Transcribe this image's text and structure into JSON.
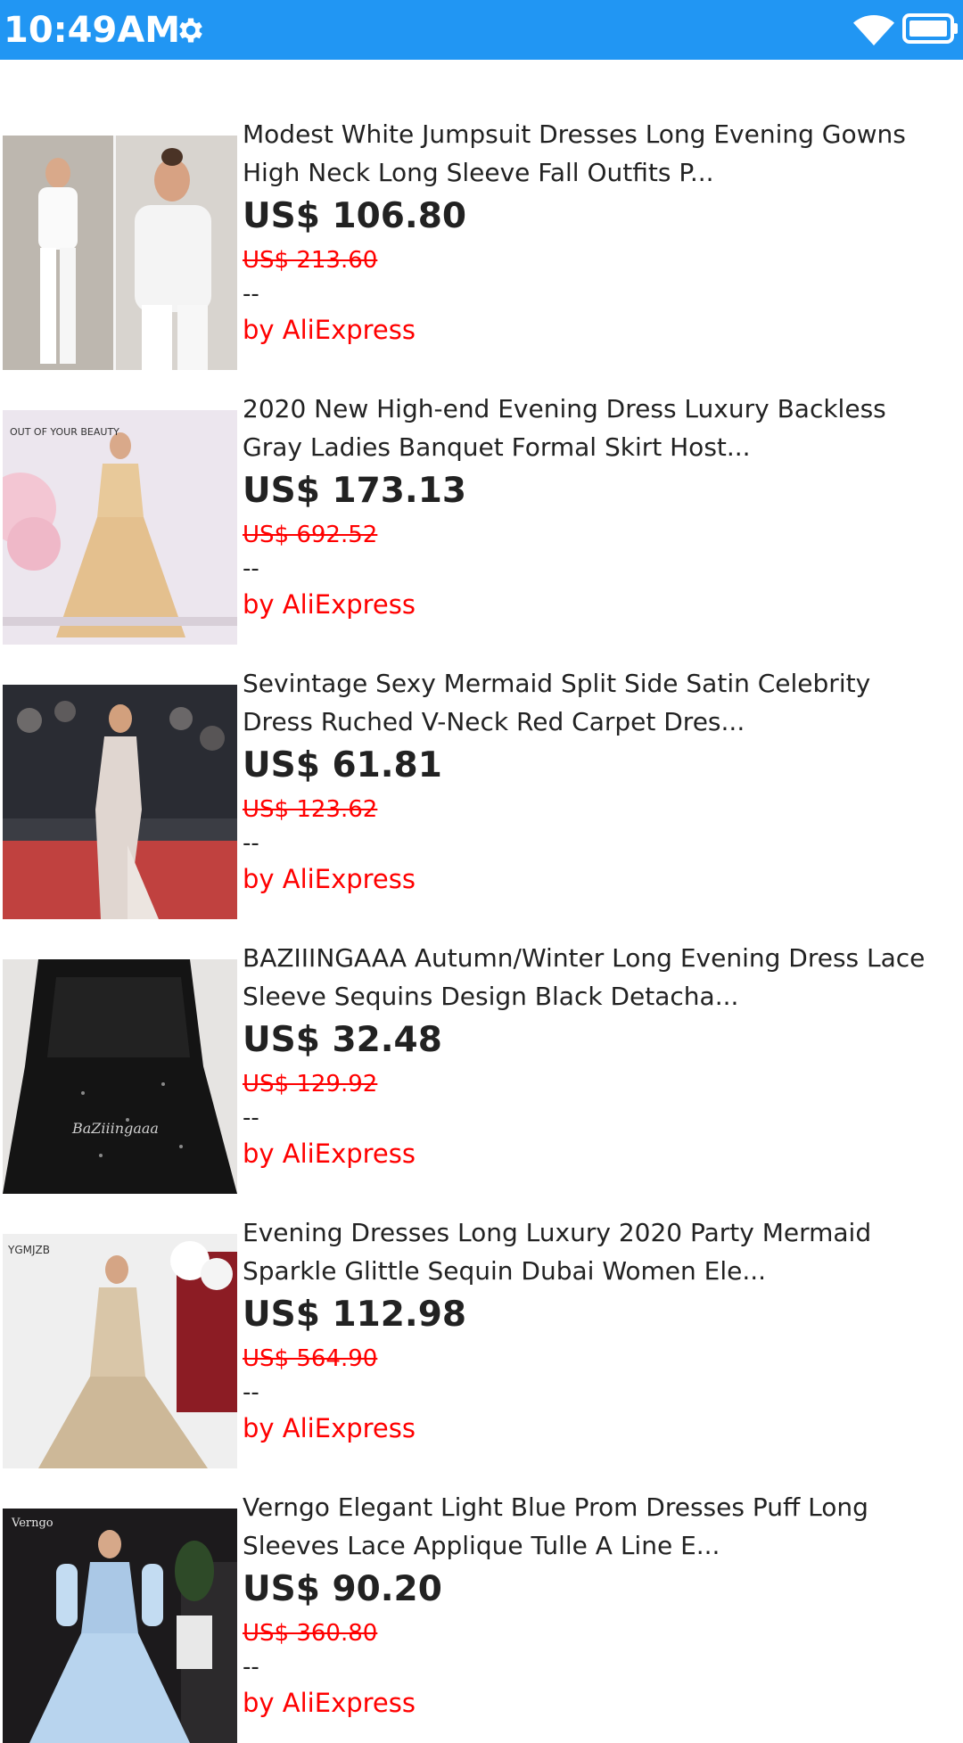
{
  "status_bar": {
    "time": "10:49AM",
    "color": "#2196F3",
    "icons": [
      "gear-icon",
      "wifi-icon",
      "battery-icon"
    ]
  },
  "products": [
    {
      "title_line1": "Modest White Jumpsuit Dresses Long Evening Gowns",
      "title_line2": "High Neck Long Sleeve Fall Outfits P...",
      "price": "US$ 106.80",
      "original_price": "US$ 213.60",
      "rating": "--",
      "seller": "by AliExpress"
    },
    {
      "title_line1": "2020 New High-end Evening Dress Luxury Backless",
      "title_line2": "Gray Ladies Banquet Formal Skirt Host...",
      "price": "US$ 173.13",
      "original_price": "US$ 692.52",
      "rating": "--",
      "seller": "by AliExpress",
      "image_text": "OUT OF YOUR BEAUTY"
    },
    {
      "title_line1": "Sevintage Sexy Mermaid Split Side Satin Celebrity",
      "title_line2": "Dress Ruched V-Neck Red Carpet Dres...",
      "price": "US$ 61.81",
      "original_price": "US$ 123.62",
      "rating": "--",
      "seller": "by AliExpress"
    },
    {
      "title_line1": "BAZIIINGAAA Autumn/Winter Long Evening Dress Lace",
      "title_line2": "Sleeve Sequins Design Black Detacha...",
      "price": "US$ 32.48",
      "original_price": "US$ 129.92",
      "rating": "--",
      "seller": "by AliExpress",
      "image_text": "BaZiiingaaa"
    },
    {
      "title_line1": "Evening Dresses Long Luxury 2020 Party Mermaid",
      "title_line2": "Sparkle Glittle Sequin Dubai Women Ele...",
      "price": "US$ 112.98",
      "original_price": "US$ 564.90",
      "rating": "--",
      "seller": "by AliExpress",
      "image_text": "YGMJZB"
    },
    {
      "title_line1": "Verngo Elegant Light Blue Prom Dresses Puff Long",
      "title_line2": "Sleeves Lace Applique Tulle A Line E...",
      "price": "US$ 90.20",
      "original_price": "US$ 360.80",
      "rating": "--",
      "seller": "by AliExpress",
      "image_text": "Verngo"
    }
  ]
}
